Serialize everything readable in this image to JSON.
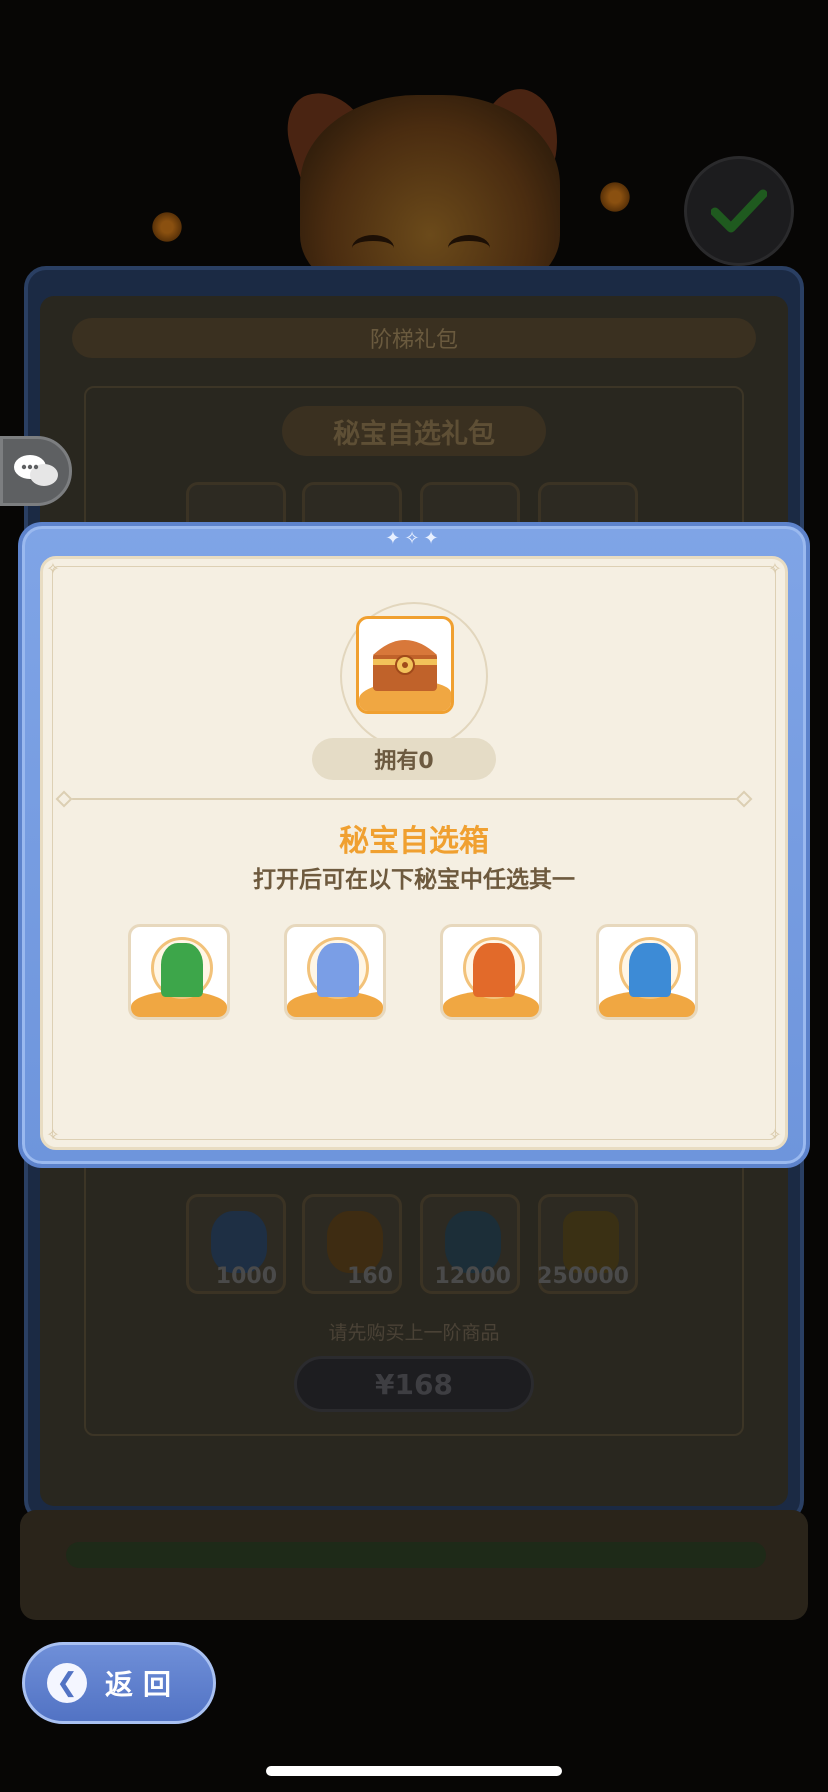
{
  "background": {
    "ladder_pack_title": "阶梯礼包",
    "pack_name": "秘宝自选礼包",
    "items_bottom": [
      {
        "icon": "hourglass-relic-icon",
        "qty": "1000",
        "color": "#3a6fb0"
      },
      {
        "icon": "golden-egg-icon",
        "qty": "160",
        "color": "#a8701c"
      },
      {
        "icon": "blue-crystal-icon",
        "qty": "12000",
        "color": "#3b7da8"
      },
      {
        "icon": "gold-coin-icon",
        "qty": "250000",
        "color": "#a8841c"
      }
    ],
    "note": "请先购买上一阶商品",
    "price": "¥168"
  },
  "modal": {
    "owned_label": "拥有0",
    "item_title": "秘宝自选箱",
    "item_description": "打开后可在以下秘宝中任选其一",
    "choices": [
      {
        "name": "jade-dragon-statue-icon",
        "color": "#3da64a"
      },
      {
        "name": "ice-dragon-statue-icon",
        "color": "#7a9ee6"
      },
      {
        "name": "phoenix-statue-icon",
        "color": "#e26a2a"
      },
      {
        "name": "water-serpent-statue-icon",
        "color": "#3d8bd6"
      }
    ]
  },
  "back_button": {
    "label": "返回"
  },
  "colors": {
    "modal_blue": "#7fa4e6",
    "accent_orange": "#f0a030",
    "panel_cream": "#f5efe2"
  }
}
